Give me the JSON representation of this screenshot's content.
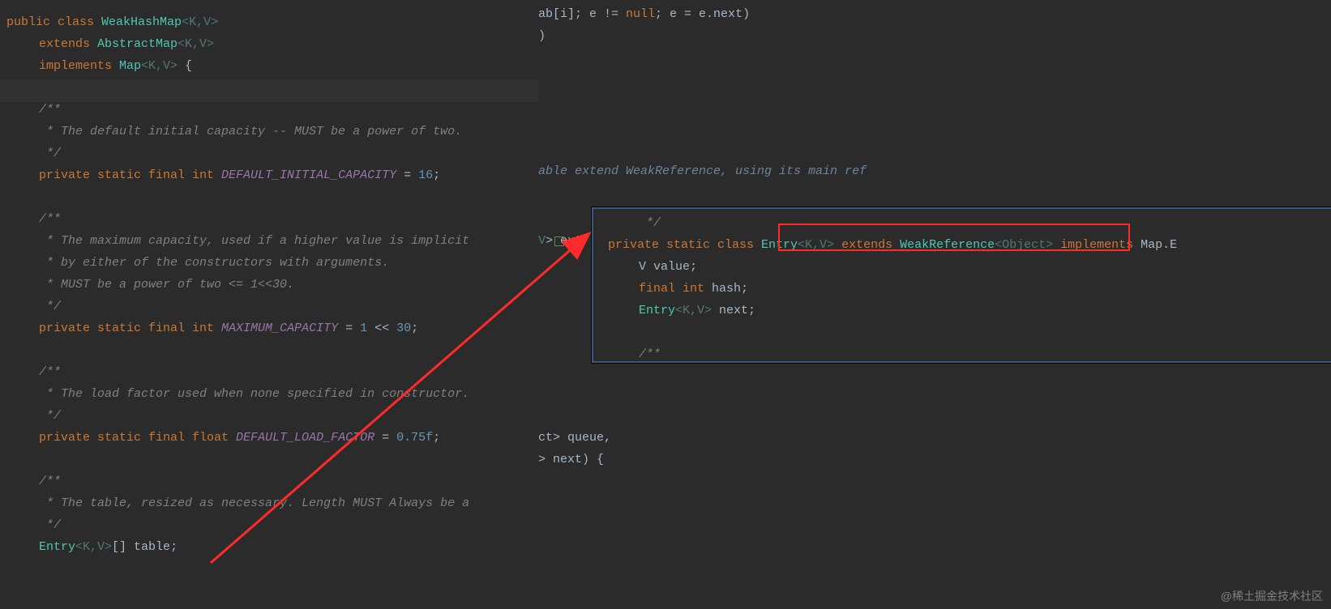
{
  "left": {
    "l1_public": "public ",
    "l1_class": "class ",
    "l1_name": "WeakHashMap",
    "l1_gen": "<K,V>",
    "l2_extends": "extends ",
    "l2_abs": "AbstractMap",
    "l2_gen": "<K,V>",
    "l3_impl": "implements ",
    "l3_map": "Map",
    "l3_gen": "<K,V>",
    "l3_brace": " {",
    "c1_a": "/**",
    "c1_b": " * The default initial capacity -- MUST be a power of two.",
    "c1_c": " */",
    "f1_mods": "private static final int ",
    "f1_name": "DEFAULT_INITIAL_CAPACITY",
    "f1_rest": " = ",
    "f1_num": "16",
    "f1_semi": ";",
    "c2_a": "/**",
    "c2_b": " * The maximum capacity, used if a higher value is implicit",
    "c2_c": " * by either of the constructors with arguments.",
    "c2_d": " * MUST be a power of two <= 1<<30.",
    "c2_e": " */",
    "f2_mods": "private static final int ",
    "f2_name": "MAXIMUM_CAPACITY",
    "f2_rest": " = ",
    "f2_num": "1",
    "f2_op": " << ",
    "f2_num2": "30",
    "f2_semi": ";",
    "c3_a": "/**",
    "c3_b": " * The load factor used when none specified in constructor.",
    "c3_c": " */",
    "f3_mods": "private static final float ",
    "f3_name": "DEFAULT_LOAD_FACTOR",
    "f3_rest": " = ",
    "f3_num": "0.75f",
    "f3_semi": ";",
    "c4_a": "/**",
    "c4_b": " * The table, resized as necessary. Length MUST Always be a",
    "c4_c": " */",
    "f4_type": "Entry",
    "f4_gen": "<K,V>",
    "f4_arr": "[] ",
    "f4_name": "table",
    "f4_semi": ";"
  },
  "right": {
    "r1_a": "ab[i]; e != ",
    "r1_null": "null",
    "r1_b": "; e = e.next)",
    "r2": ")",
    "r3": "able extend WeakReference, using its main ref",
    "r4_a": "> ext",
    "r4_v": "V",
    "r5_a": "ct> queue,",
    "r5_b": "> next) {"
  },
  "popup": {
    "p0": " */",
    "p1_priv": "private static class ",
    "p1_entry": "Entry",
    "p1_gen": "<K,V>",
    "p1_ext": " extends ",
    "p1_wr": "WeakReference",
    "p1_obj": "<Object>",
    "p1_impl": " implements ",
    "p1_map": "Map.E",
    "p2_v": "V value;",
    "p3_a": "final int ",
    "p3_b": "hash",
    "p3_c": ";",
    "p4_a": "Entry",
    "p4_b": "<K,V>",
    "p4_c": " next;",
    "p5": "/**"
  },
  "watermark": "@稀土掘金技术社区"
}
